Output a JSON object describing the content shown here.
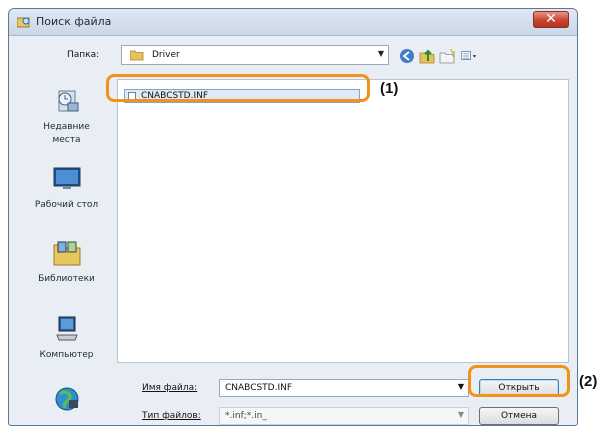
{
  "window": {
    "title": "Поиск файла",
    "close_label": "✕"
  },
  "toolbar": {
    "lookin_label": "Папка:",
    "lookin_value": "Driver",
    "icons": [
      "back-icon",
      "up-folder-icon",
      "new-folder-icon",
      "view-menu-icon"
    ]
  },
  "places": [
    {
      "label": "Недавние места",
      "icon": "recent-places-icon"
    },
    {
      "label": "Рабочий стол",
      "icon": "desktop-icon"
    },
    {
      "label": "Библиотеки",
      "icon": "libraries-icon"
    },
    {
      "label": "Компьютер",
      "icon": "computer-icon"
    },
    {
      "label": "",
      "icon": "network-icon"
    }
  ],
  "files": [
    {
      "name": "CNABCSTD.INF",
      "selected": true
    }
  ],
  "bottom": {
    "filename_label": "Имя файла:",
    "filename_value": "CNABCSTD.INF",
    "filetype_label": "Тип файлов:",
    "filetype_value": "*.inf;*.in_",
    "open_button": "Открыть",
    "cancel_button": "Отмена"
  },
  "callouts": {
    "first": "(1)",
    "second": "(2)"
  },
  "colors": {
    "highlight": "#f2921c",
    "close_button": "#c74532",
    "selection": "#dfeaf7"
  }
}
